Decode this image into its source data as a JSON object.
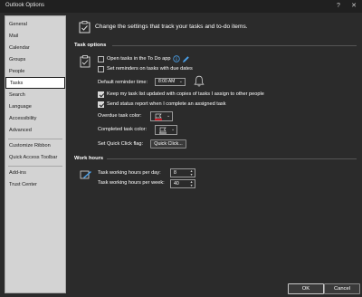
{
  "window": {
    "title": "Outlook Options",
    "help_glyph": "?",
    "close_glyph": "✕"
  },
  "sidebar": {
    "items": [
      {
        "label": "General"
      },
      {
        "label": "Mail"
      },
      {
        "label": "Calendar"
      },
      {
        "label": "Groups"
      },
      {
        "label": "People"
      },
      {
        "label": "Tasks",
        "selected": true
      },
      {
        "label": "Search"
      },
      {
        "label": "Language"
      },
      {
        "label": "Accessibility"
      },
      {
        "label": "Advanced"
      },
      {
        "label": "Customize Ribbon"
      },
      {
        "label": "Quick Access Toolbar"
      },
      {
        "label": "Add-ins"
      },
      {
        "label": "Trust Center"
      }
    ]
  },
  "header": {
    "text": "Change the settings that track your tasks and to-do items."
  },
  "task_options": {
    "title": "Task options",
    "open_in_todo": {
      "label": "Open tasks in the To Do app",
      "checked": false
    },
    "set_reminders": {
      "label": "Set reminders on tasks with due dates",
      "checked": false
    },
    "default_reminder_time": {
      "label": "Default reminder time:",
      "value": "8:00 AM"
    },
    "keep_updated": {
      "label": "Keep my task list updated with copies of tasks I assign to other people",
      "checked": true
    },
    "send_status": {
      "label": "Send status report when I complete an assigned task",
      "checked": true
    },
    "overdue_color": {
      "label": "Overdue task color:",
      "color": "#e81123"
    },
    "completed_color": {
      "label": "Completed task color:",
      "color": "#a0a0a0"
    },
    "quick_click": {
      "label": "Set Quick Click flag:",
      "button": "Quick Click..."
    }
  },
  "work_hours": {
    "title": "Work hours",
    "per_day": {
      "label": "Task working hours per day:",
      "value": "8"
    },
    "per_week": {
      "label": "Task working hours per week:",
      "value": "40"
    }
  },
  "footer": {
    "ok": "OK",
    "cancel": "Cancel"
  },
  "colors": {
    "accent_blue": "#4a9fe8",
    "background": "#2b2b2b",
    "sidebar": "#d3d3d3"
  }
}
